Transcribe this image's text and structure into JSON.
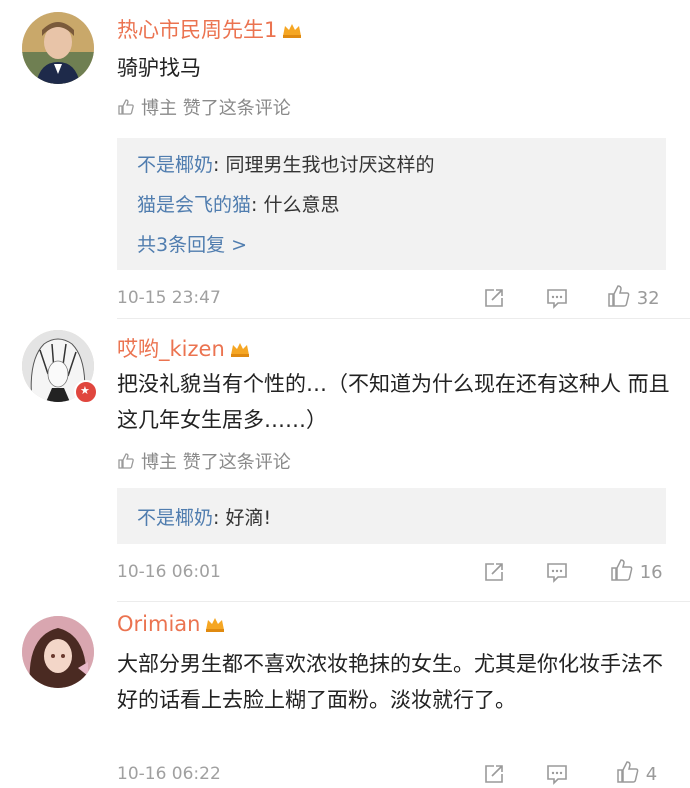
{
  "comments": [
    {
      "username": "热心市民周先生1",
      "text": "骑驴找马",
      "liked_by_author": "博主 赞了这条评论",
      "replies": [
        {
          "name": "不是椰奶",
          "text": ": 同理男生我也讨厌这样的"
        },
        {
          "name": "猫是会飞的猫",
          "text": ": 什么意思"
        }
      ],
      "more_replies": "共3条回复 >",
      "time": "10-15 23:47",
      "likes": "32"
    },
    {
      "username": "哎哟_kizen",
      "text": "把没礼貌当有个性的…（不知道为什么现在还有这种人 而且这几年女生居多……）",
      "liked_by_author": "博主 赞了这条评论",
      "replies": [
        {
          "name": "不是椰奶",
          "text": ": 好滴!"
        }
      ],
      "time": "10-16 06:01",
      "likes": "16"
    },
    {
      "username": "Orimian",
      "text": "大部分男生都不喜欢浓妆艳抹的女生。尤其是你化妆手法不好的话看上去脸上糊了面粉。淡妆就行了。",
      "time": "10-16 06:22",
      "likes": "4"
    }
  ],
  "colors": {
    "username": "#eb7350",
    "link": "#507daf",
    "meta": "#a0a0a0",
    "reply_bg": "#f2f2f2"
  },
  "icons": [
    "crown-icon",
    "thumb-up-icon",
    "share-icon",
    "comment-icon",
    "like-icon"
  ]
}
